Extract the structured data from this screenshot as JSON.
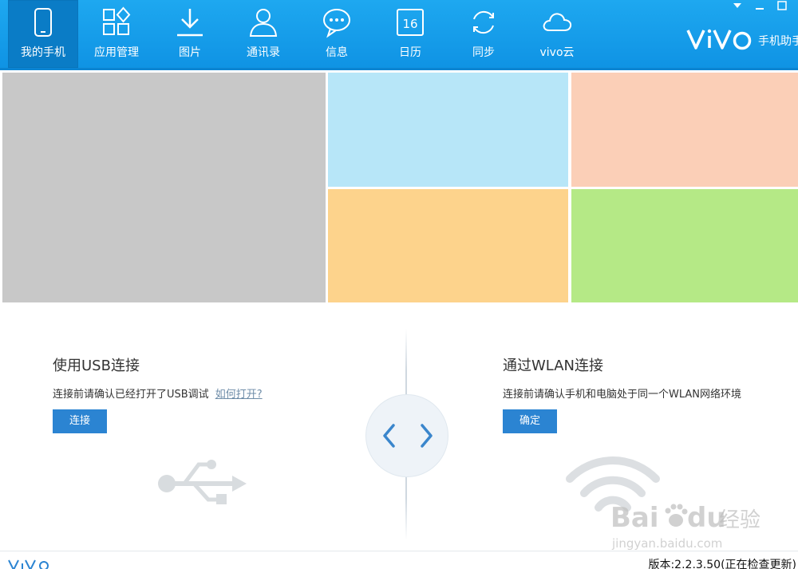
{
  "nav": {
    "items": [
      {
        "label": "我的手机",
        "icon": "phone-icon"
      },
      {
        "label": "应用管理",
        "icon": "apps-icon"
      },
      {
        "label": "图片",
        "icon": "download-icon"
      },
      {
        "label": "通讯录",
        "icon": "contact-icon"
      },
      {
        "label": "信息",
        "icon": "message-icon"
      },
      {
        "label": "日历",
        "icon": "calendar-icon"
      },
      {
        "label": "同步",
        "icon": "sync-icon"
      },
      {
        "label": "vivo云",
        "icon": "cloud-icon"
      }
    ],
    "active_index": 0,
    "calendar_day": "16"
  },
  "brand": {
    "text": "手机助手"
  },
  "window_controls": {
    "minimize_icon": "minimize-icon",
    "close_icon": "close-icon"
  },
  "banner": {
    "tile_colors": [
      "#c8c8c8",
      "#b7e6f8",
      "#fbcfb7",
      "#fdd38c",
      "#b5e986"
    ]
  },
  "usb_panel": {
    "title": "使用USB连接",
    "description": "连接前请确认已经打开了USB调试",
    "help_link": "如何打开?",
    "button": "连接"
  },
  "wlan_panel": {
    "title": "通过WLAN连接",
    "description": "连接前请确认手机和电脑处于同一个WLAN网络环境",
    "button": "确定"
  },
  "switcher": {
    "prev_icon": "chevron-left-icon",
    "next_icon": "chevron-right-icon"
  },
  "footer": {
    "version": "版本:2.2.3.50(正在检查更新)"
  },
  "colors": {
    "toolbar": "#1ea8f0",
    "toolbar_active": "#0a7cc6",
    "button": "#2b84d2",
    "link": "#6e8ca8"
  }
}
